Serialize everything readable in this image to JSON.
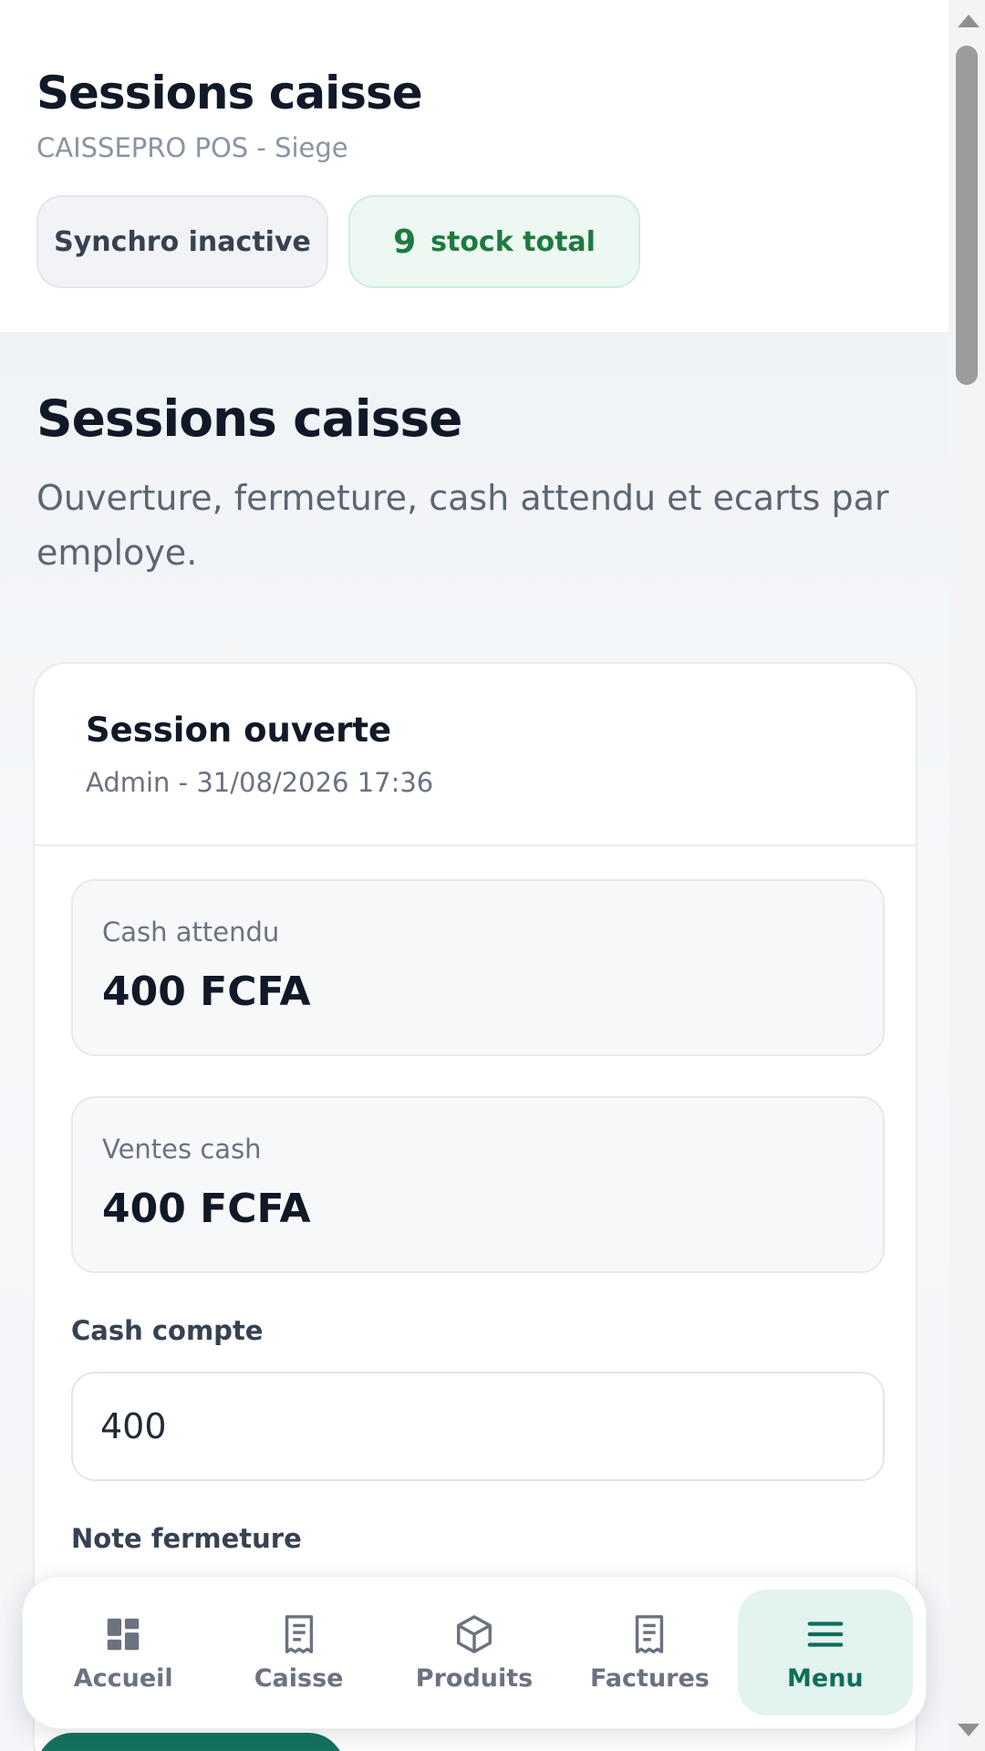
{
  "header": {
    "title": "Sessions caisse",
    "subtitle": "CAISSEPRO POS - Siege",
    "sync_pill": "Synchro inactive",
    "stock_count": "9",
    "stock_label": "stock total"
  },
  "page": {
    "title": "Sessions caisse",
    "description": "Ouverture, fermeture, cash attendu et ecarts par employe."
  },
  "session": {
    "title": "Session ouverte",
    "meta": "Admin - 31/08/2026 17:36",
    "cash_expected_label": "Cash attendu",
    "cash_expected_value": "400 FCFA",
    "cash_sales_label": "Ventes cash",
    "cash_sales_value": "400 FCFA",
    "cash_counted_label": "Cash compte",
    "cash_counted_value": "400",
    "closing_note_label": "Note fermeture"
  },
  "nav": {
    "items": [
      {
        "label": "Accueil",
        "icon": "dashboard-icon"
      },
      {
        "label": "Caisse",
        "icon": "receipt-icon"
      },
      {
        "label": "Produits",
        "icon": "box-icon"
      },
      {
        "label": "Factures",
        "icon": "invoice-icon"
      },
      {
        "label": "Menu",
        "icon": "menu-icon",
        "active": true
      }
    ]
  },
  "colors": {
    "accent": "#0f6e5a",
    "stock_green": "#1e7a3f",
    "active_nav_bg": "#e3f3ef"
  }
}
